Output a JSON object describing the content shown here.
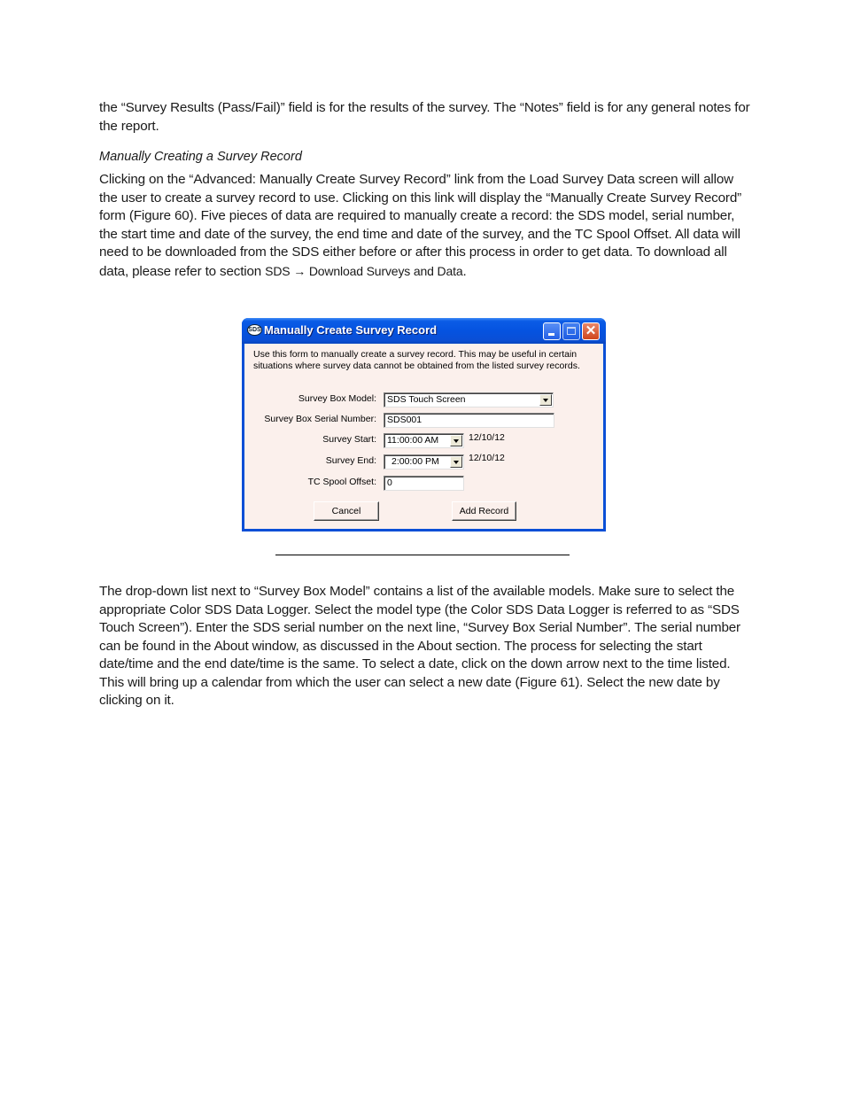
{
  "document": {
    "para1": "the “Survey Results (Pass/Fail)” field is for the results of the survey.  The “Notes” field is for any general notes for the report.",
    "heading": "Manually Creating a Survey Record",
    "para2": "Clicking on the “Advanced: Manually Create Survey Record” link from the Load Survey Data screen will allow the user to create a survey record to use.  Clicking on this link will display the “Manually Create Survey Record” form (Figure 60).  Five pieces of data are required to manually create a record: the SDS model, serial number, the start time and date of the survey, the end time and date of the survey, and the TC Spool Offset. All data will need to be downloaded from the SDS either before or after this process in order to get data.  To download all data, please refer to section ",
    "para2_ref": "SDS → Download Surveys and Data",
    "para2_end": ".",
    "para3": "The drop-down list next to “Survey Box Model” contains a list of the available models. Make sure to select the appropriate Color SDS Data Logger. Select the model type (the Color SDS Data Logger is referred to as “SDS Touch Screen”). Enter the SDS serial number on the next line, “Survey Box Serial Number”.  The serial number can be found in the About window, as discussed in the About section.  The process for selecting the start date/time and the end date/time is the same.  To select a date, click on the down arrow next to the time listed.  This will bring up a calendar from which the user can select a new date (Figure 61).  Select the new date by clicking on it."
  },
  "dialog": {
    "title": "Manually Create Survey Record",
    "icon": "sds-app-icon",
    "icon_text": "SDS",
    "close_glyph": "✕",
    "intro": "Use this form to manually create a survey record.  This may be useful in certain situations where survey data cannot be obtained from the listed survey records.",
    "fields": {
      "model_label": "Survey Box Model:",
      "model_value": "SDS Touch Screen",
      "serial_label": "Survey Box Serial Number:",
      "serial_value": "SDS001",
      "start_label": "Survey Start:",
      "start_time": "11:00:00 AM",
      "start_date": "12/10/12",
      "end_label": "Survey End:",
      "end_time": "2:00:00 PM",
      "end_date": "12/10/12",
      "offset_label": "TC Spool Offset:",
      "offset_value": "0"
    },
    "buttons": {
      "cancel": "Cancel",
      "add_record": "Add Record"
    },
    "colors": {
      "titlebar": "#0553e0",
      "client_bg": "#fbf0ec",
      "close_button": "#d0451c"
    }
  }
}
